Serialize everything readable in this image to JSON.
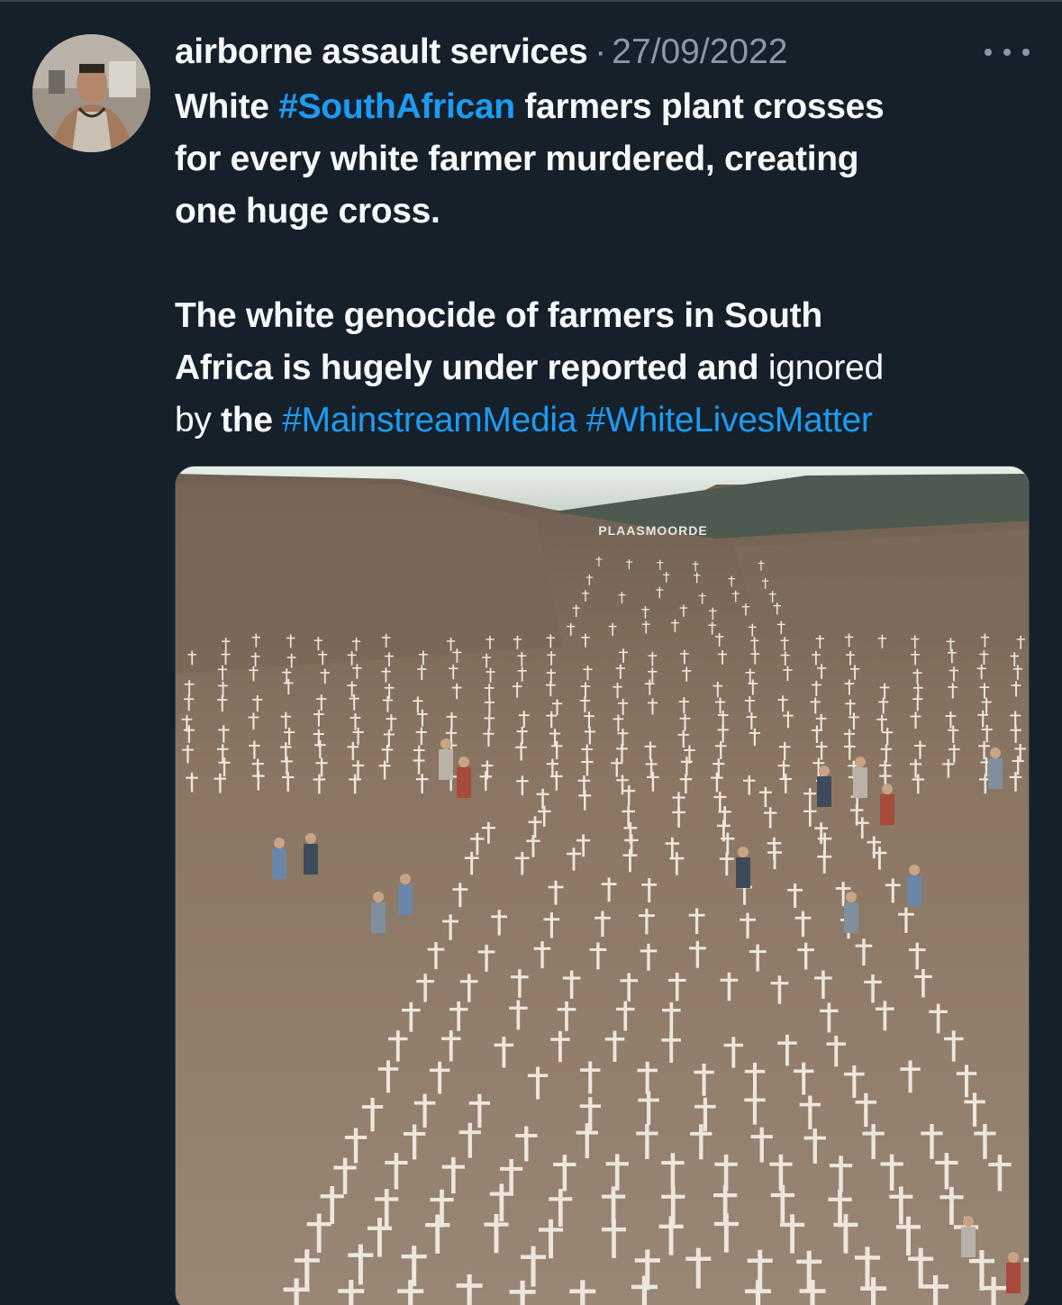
{
  "tweet": {
    "author_name": "airborne assault services",
    "separator": "·",
    "date": "27/09/2022",
    "more_icon": "more-horizontal-icon",
    "avatar_icon": "profile-photo",
    "text": {
      "l1_a": "White ",
      "l1_tag": "#SouthAfrican",
      "l1_b": " farmers plant crosses",
      "l2": "for every white farmer murdered, creating",
      "l3": "one huge cross.",
      "l4": "The white genocide of farmers in South",
      "l5_a": "Africa is hugely under reported and ",
      "l5_b": "ignored",
      "l6_a": "by ",
      "l6_b": "the",
      "l6_space": " ",
      "l6_tag1": "#MainstreamMedia",
      "l6_space2": " ",
      "l6_tag2": "#WhiteLivesMatter"
    },
    "media": {
      "sign_text": "PLAASMOORDE",
      "description_icon": "hillside-crosses-photo"
    }
  },
  "colors": {
    "background": "#15202b",
    "text": "#f7f9f9",
    "muted": "#8b98a5",
    "link": "#1d9bf0"
  }
}
